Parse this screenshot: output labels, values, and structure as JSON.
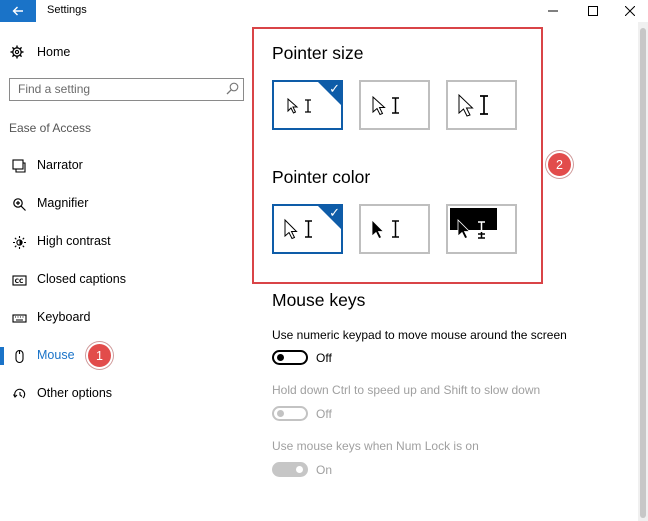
{
  "window": {
    "title": "Settings"
  },
  "sidebar": {
    "home_label": "Home",
    "search_placeholder": "Find a setting",
    "section_label": "Ease of Access",
    "items": [
      {
        "label": "Narrator",
        "icon": "narrator-icon",
        "active": false
      },
      {
        "label": "Magnifier",
        "icon": "magnifier-icon",
        "active": false
      },
      {
        "label": "High contrast",
        "icon": "high-contrast-icon",
        "active": false
      },
      {
        "label": "Closed captions",
        "icon": "closed-captions-icon",
        "active": false
      },
      {
        "label": "Keyboard",
        "icon": "keyboard-icon",
        "active": false
      },
      {
        "label": "Mouse",
        "icon": "mouse-icon",
        "active": true
      },
      {
        "label": "Other options",
        "icon": "other-options-icon",
        "active": false
      }
    ],
    "badge": "1"
  },
  "main": {
    "badge": "2",
    "pointer_size": {
      "heading": "Pointer size",
      "selected_index": 0
    },
    "pointer_color": {
      "heading": "Pointer color",
      "selected_index": 0,
      "options": [
        "white",
        "black",
        "inverted"
      ]
    },
    "mouse_keys": {
      "heading": "Mouse keys",
      "settings": [
        {
          "label": "Use numeric keypad to move mouse around the screen",
          "state": "Off",
          "enabled": true
        },
        {
          "label": "Hold down Ctrl to speed up and Shift to slow down",
          "state": "Off",
          "enabled": false
        },
        {
          "label": "Use mouse keys when Num Lock is on",
          "state": "On",
          "enabled": false
        }
      ]
    }
  },
  "colors": {
    "accent": "#1a73c8",
    "selected_border": "#0e5ca8",
    "highlight": "#d94447",
    "badge": "#e24c4b"
  }
}
